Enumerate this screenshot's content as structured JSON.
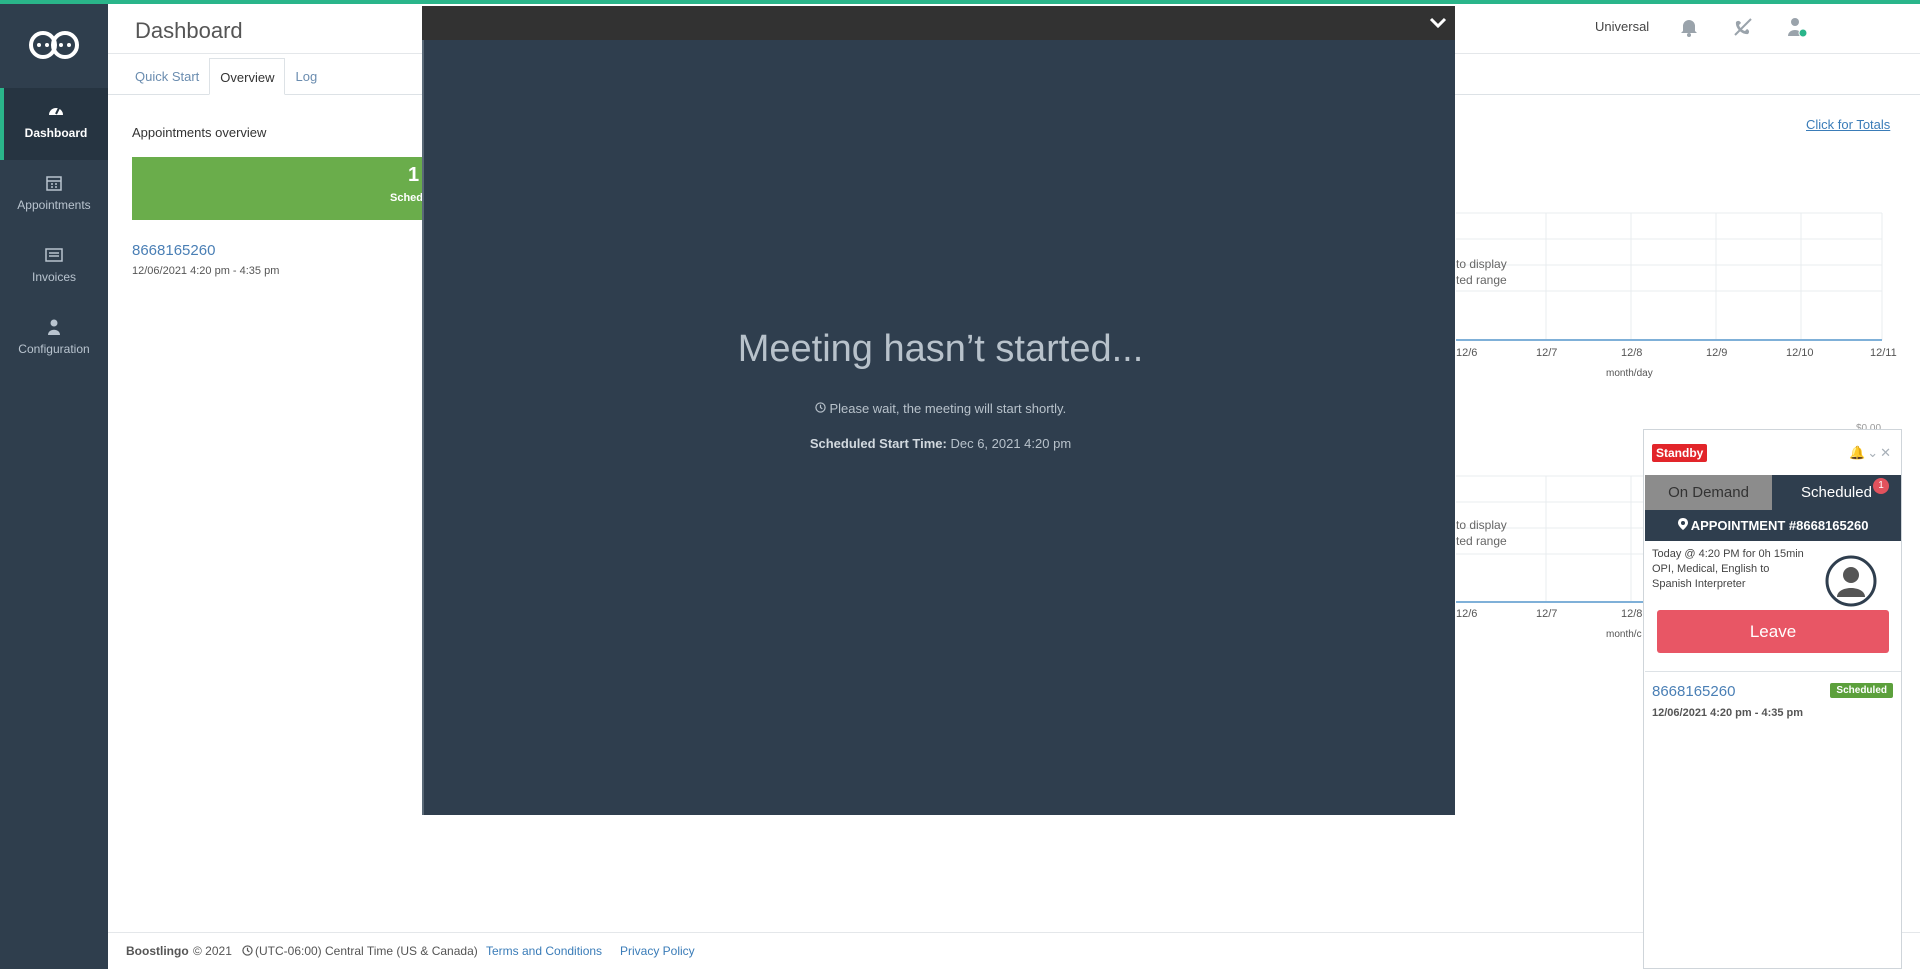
{
  "app": {
    "title": "Dashboard"
  },
  "sidebar": {
    "items": [
      {
        "label": "Dashboard",
        "icon": "gauge-icon",
        "active": true
      },
      {
        "label": "Appointments",
        "icon": "calendar-icon"
      },
      {
        "label": "Invoices",
        "icon": "invoice-icon"
      },
      {
        "label": "Configuration",
        "icon": "user-icon"
      }
    ]
  },
  "header": {
    "user_label": "Universal"
  },
  "tabs": [
    {
      "label": "Quick Start"
    },
    {
      "label": "Overview",
      "active": true
    },
    {
      "label": "Log"
    }
  ],
  "overview": {
    "section_title": "Appointments overview",
    "scheduled_count": "1",
    "scheduled_label": "Schedu",
    "totals_link": "Click for Totals",
    "appointment": {
      "number": "8668165260",
      "time": "12/06/2021 4:20 pm - 4:35 pm"
    }
  },
  "charts": {
    "no_data_line1": "to display",
    "no_data_line2": "ted range",
    "x_ticks": [
      "12/6",
      "12/7",
      "12/8",
      "12/9",
      "12/10",
      "12/11"
    ],
    "x_label": "month/day",
    "chart2_x_ticks": [
      "12/6",
      "12/7",
      "12/8"
    ],
    "chart2_x_label": "month/c",
    "chart2_partial_label": "$0.00"
  },
  "meeting": {
    "title": "Meeting hasn’t started...",
    "wait_text": "Please wait, the meeting will start shortly.",
    "scheduled_label": "Scheduled Start Time:",
    "scheduled_value": "Dec 6, 2021 4:20 pm"
  },
  "widget": {
    "status": "Standby",
    "tab_on_demand": "On Demand",
    "tab_scheduled": "Scheduled",
    "scheduled_badge": "1",
    "appointment_title": "APPOINTMENT #8668165260",
    "details_line1": "Today @ 4:20 PM for 0h 15min",
    "details_line2": "OPI, Medical, English to",
    "details_line3": "Spanish Interpreter",
    "leave_label": "Leave",
    "list_number": "8668165260",
    "list_badge": "Scheduled",
    "list_time": "12/06/2021 4:20 pm - 4:35 pm"
  },
  "footer": {
    "brand": "Boostlingo",
    "copyright": "© 2021",
    "timezone": "(UTC-06:00) Central Time (US & Canada)",
    "terms": "Terms and Conditions",
    "privacy": "Privacy Policy"
  },
  "colors": {
    "accent": "#2ab58a",
    "sidebar": "#2f3e4d",
    "meeting_bg": "#2f3e4e",
    "leave": "#e85665",
    "standby": "#e2252a"
  }
}
